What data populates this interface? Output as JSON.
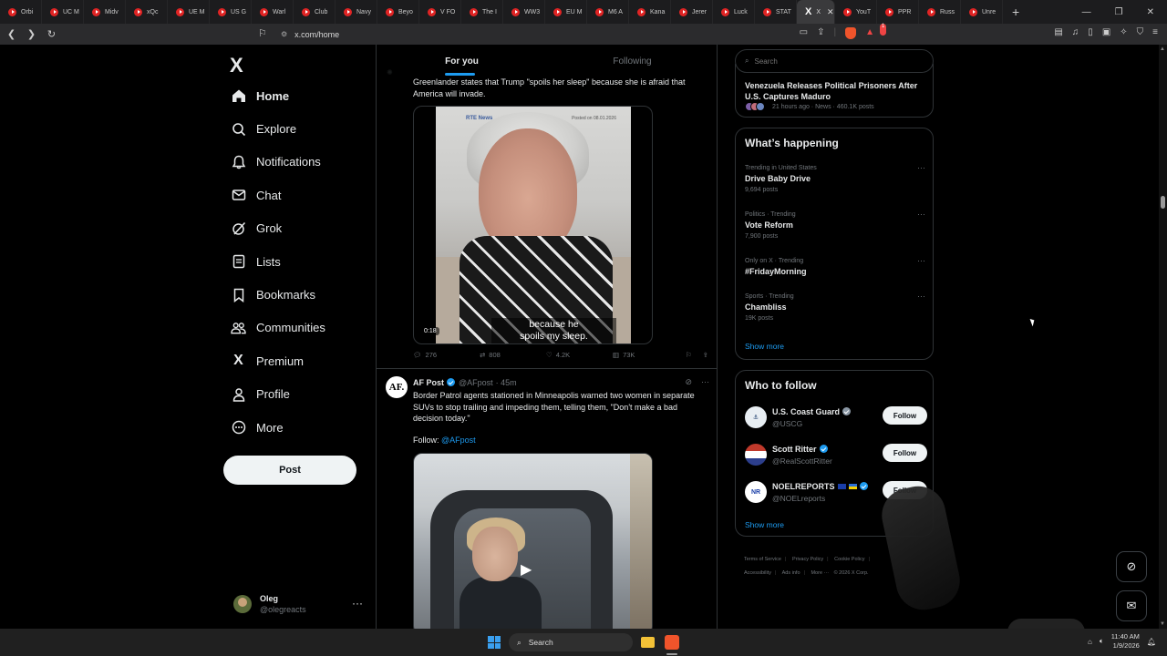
{
  "browser": {
    "tabs": [
      {
        "label": "Orbi"
      },
      {
        "label": "UC M"
      },
      {
        "label": "Midv"
      },
      {
        "label": "xQc"
      },
      {
        "label": "UE M"
      },
      {
        "label": "US G"
      },
      {
        "label": "Warl"
      },
      {
        "label": "Club"
      },
      {
        "label": "Navy"
      },
      {
        "label": "Beyo"
      },
      {
        "label": "V FO"
      },
      {
        "label": "The I"
      },
      {
        "label": "WW3"
      },
      {
        "label": "EU M"
      },
      {
        "label": "M6 A"
      },
      {
        "label": "Kana"
      },
      {
        "label": "Jerer"
      },
      {
        "label": "Luck"
      },
      {
        "label": "STAT"
      }
    ],
    "active_tab": {
      "label": "X",
      "favicon": "X"
    },
    "tabs_after": [
      {
        "label": "YouT"
      },
      {
        "label": "PPR"
      },
      {
        "label": "Russ"
      },
      {
        "label": "Unre"
      }
    ],
    "url": "x.com/home",
    "shield_badge": "1"
  },
  "nav": {
    "logo": "X",
    "items": [
      {
        "label": "Home",
        "icon": "home-icon"
      },
      {
        "label": "Explore",
        "icon": "search-icon"
      },
      {
        "label": "Notifications",
        "icon": "bell-icon"
      },
      {
        "label": "Chat",
        "icon": "mail-icon"
      },
      {
        "label": "Grok",
        "icon": "grok-icon"
      },
      {
        "label": "Lists",
        "icon": "lists-icon"
      },
      {
        "label": "Bookmarks",
        "icon": "bookmark-icon"
      },
      {
        "label": "Communities",
        "icon": "communities-icon"
      },
      {
        "label": "Premium",
        "icon": "x-icon"
      },
      {
        "label": "Profile",
        "icon": "person-icon"
      },
      {
        "label": "More",
        "icon": "more-icon"
      }
    ],
    "post_label": "Post"
  },
  "account": {
    "name": "Oleg",
    "handle": "@olegreacts",
    "more": "···"
  },
  "feed": {
    "tabs": [
      {
        "label": "For you"
      },
      {
        "label": "Following"
      }
    ],
    "post1": {
      "text": "Greenlander states that Trump \"spoils her sleep\" because she is afraid that America will invade.",
      "media": {
        "watermark": "RTE News",
        "date_mark": "Posted on 08.01.2026",
        "caption_line1": "because he",
        "caption_line2": "spoils my sleep.",
        "duration": "0:18"
      },
      "stats": {
        "replies": "276",
        "reposts": "808",
        "likes": "4.2K",
        "views": "73K"
      }
    },
    "post2": {
      "avatar_text": "AF.",
      "name": "AF Post",
      "handle": "@AFpost",
      "time": "· 45m",
      "text": "Border Patrol agents stationed in Minneapolis warned two women in separate SUVs to stop trailing and impeding them, telling them, \"Don't make a bad decision today.\"",
      "follow_prefix": "Follow: ",
      "follow_link": "@AFpost"
    }
  },
  "right": {
    "search_placeholder": "Search",
    "news": {
      "title": "Venezuela Releases Political Prisoners After U.S. Captures Maduro",
      "meta": "21 hours ago · News · 460.1K posts"
    },
    "happening": {
      "title": "What’s happening",
      "trends": [
        {
          "category": "Trending in United States",
          "name": "Drive Baby Drive",
          "posts": "9,694 posts"
        },
        {
          "category": "Politics · Trending",
          "name": "Vote Reform",
          "posts": "7,900 posts"
        },
        {
          "category": "Only on X · Trending",
          "name": "#FridayMorning",
          "posts": ""
        },
        {
          "category": "Sports · Trending",
          "name": "Chambliss",
          "posts": "19K posts"
        }
      ],
      "show_more": "Show more"
    },
    "who_to_follow": {
      "title": "Who to follow",
      "accounts": [
        {
          "name": "U.S. Coast Guard",
          "handle": "@USCG",
          "button": "Follow"
        },
        {
          "name": "Scott Ritter",
          "handle": "@RealScottRitter",
          "button": "Follow"
        },
        {
          "name": "NOELREPORTS",
          "handle": "@NOELreports",
          "button": "Follow",
          "avatar_text": "NR"
        }
      ],
      "show_more": "Show more"
    },
    "footer": {
      "links": [
        "Terms of Service",
        "Privacy Policy",
        "Cookie Policy",
        "Accessibility",
        "Ads info",
        "More ···"
      ],
      "copyright": "© 2026 X Corp."
    }
  },
  "taskbar": {
    "search_label": "Search",
    "time": "11:40 AM",
    "date": "1/9/2026"
  },
  "colors": {
    "accent": "#1d9bf0",
    "background": "#000000",
    "border": "#2f3336",
    "muted": "#71767b"
  }
}
